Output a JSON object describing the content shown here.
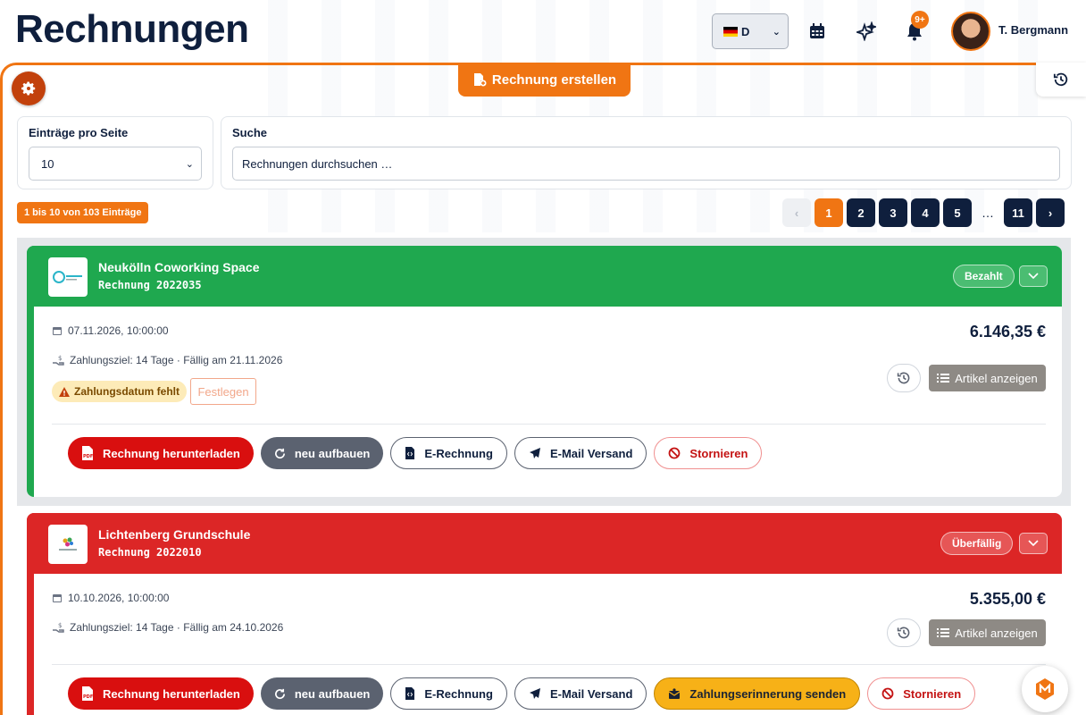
{
  "header": {
    "title": "Rechnungen",
    "language": "D",
    "notifications_badge": "9+",
    "user_name": "T. Bergmann"
  },
  "toolbar": {
    "create_label": "Rechnung erstellen"
  },
  "filters": {
    "per_page_label": "Einträge pro Seite",
    "per_page_value": "10",
    "search_label": "Suche",
    "search_placeholder": "Rechnungen durchsuchen …"
  },
  "summary": {
    "count_text": "1 bis 10 von 103 Einträge"
  },
  "pagination": {
    "pages": [
      "1",
      "2",
      "3",
      "4",
      "5"
    ],
    "dots": "…",
    "last": "11",
    "current": "1"
  },
  "invoices": [
    {
      "client": "Neukölln Coworking Space",
      "number": "Rechnung 2022035",
      "status": "Bezahlt",
      "status_color": "#1fa84f",
      "date": "07.11.2026, 10:00:00",
      "terms": "Zahlungsziel: 14 Tage · Fällig am 21.11.2026",
      "amount": "6.146,35 €",
      "warning": "Zahlungsdatum fehlt",
      "fix_label": "Festlegen",
      "articles_label": "Artikel anzeigen",
      "actions": {
        "download": "Rechnung herunterladen",
        "rebuild": "neu aufbauen",
        "einvoice": "E-Rechnung",
        "email": "E-Mail Versand",
        "cancel": "Stornieren"
      }
    },
    {
      "client": "Lichtenberg Grundschule",
      "number": "Rechnung 2022010",
      "status": "Überfällig",
      "status_color": "#dc2626",
      "date": "10.10.2026, 10:00:00",
      "terms": "Zahlungsziel: 14 Tage · Fällig am 24.10.2026",
      "amount": "5.355,00 €",
      "articles_label": "Artikel anzeigen",
      "actions": {
        "download": "Rechnung herunterladen",
        "rebuild": "neu aufbauen",
        "einvoice": "E-Rechnung",
        "email": "E-Mail Versand",
        "reminder": "Zahlungserinnerung senden",
        "cancel": "Stornieren"
      }
    }
  ],
  "icons": {
    "settings": "gear-icon",
    "calendar": "calendar-icon",
    "sparkle": "sparkle-icon",
    "bell": "bell-icon",
    "history": "history-icon",
    "help": "help-icon"
  },
  "colors": {
    "accent": "#f07513",
    "navy": "#0f1f3d",
    "paid": "#1fa84f",
    "overdue": "#dc2626"
  }
}
